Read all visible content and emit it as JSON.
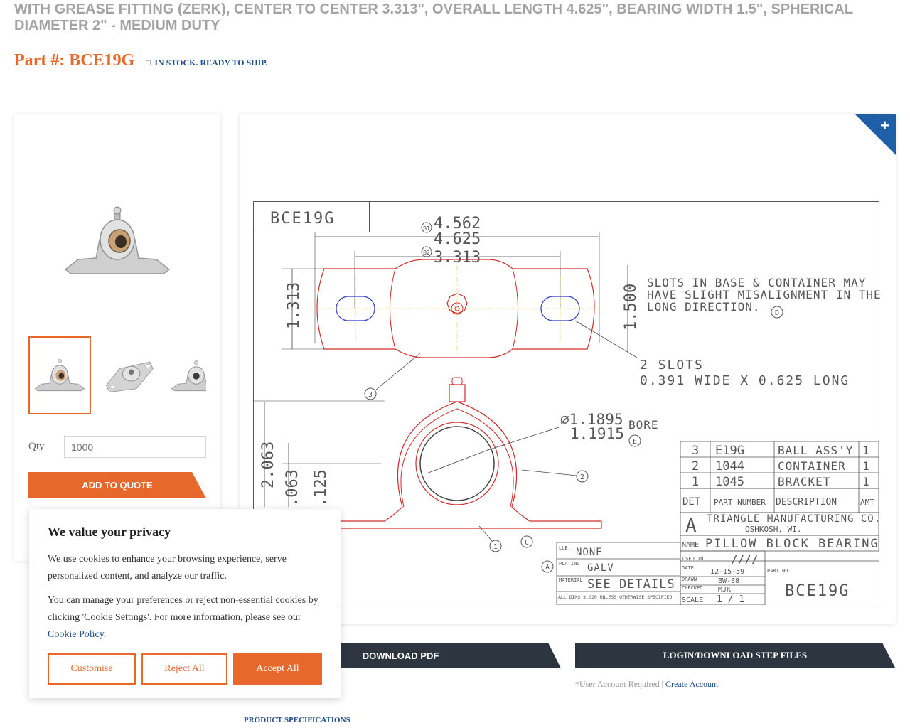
{
  "product": {
    "title": "WITH GREASE FITTING (ZERK), CENTER TO CENTER 3.313\", OVERALL LENGTH 4.625\", BEARING WIDTH 1.5\", SPHERICAL DIAMETER 2\" - MEDIUM DUTY",
    "part_label": "Part #: BCE19G",
    "stock_status": "IN STOCK. READY TO SHIP."
  },
  "purchase": {
    "qty_label": "Qty",
    "qty_placeholder": "1000",
    "add_to_quote": "ADD TO QUOTE"
  },
  "drawing": {
    "part_box": "BCE19G",
    "dims": {
      "b1": "4.562",
      "b2": "4.625",
      "c2c": "3.313",
      "h1": "1.313",
      "h2": "1.500",
      "v1": "2.063",
      "v2": ".063",
      "v3": ".125",
      "bore1": "⌀1.1895",
      "bore2": "1.1915",
      "bore_label": "BORE"
    },
    "callouts": {
      "b1": "B1",
      "b2": "B2",
      "d": "D",
      "e": "E",
      "a": "A",
      "c": "C",
      "n1": "1",
      "n2": "2",
      "n3": "3"
    },
    "notes": {
      "line1": "SLOTS IN BASE & CONTAINER MAY",
      "line2": "HAVE SLIGHT MISALIGNMENT IN THE",
      "line3": "LONG DIRECTION.",
      "slots1": "2 SLOTS",
      "slots2": "0.391 WIDE X 0.625 LONG"
    },
    "bom": [
      {
        "det": "3",
        "part": "E19G",
        "desc": "BALL ASS'Y",
        "amt": "1"
      },
      {
        "det": "2",
        "part": "1044",
        "desc": "CONTAINER",
        "amt": "1"
      },
      {
        "det": "1",
        "part": "1045",
        "desc": "BRACKET",
        "amt": "1"
      }
    ],
    "bom_headers": {
      "det": "DET",
      "part": "PART NUMBER",
      "desc": "DESCRIPTION",
      "amt": "AMT"
    },
    "title_block": {
      "company": "TRIANGLE MANUFACTURING CO.",
      "city": "OSHKOSH, WI.",
      "name_label": "NAME",
      "name": "PILLOW BLOCK BEARING",
      "used_in_label": "USED IN",
      "used_in": "////",
      "date_label": "DATE",
      "date": "12-15-59",
      "drawn_label": "DRAWN",
      "drawn": "BW-88",
      "checked_label": "CHECKED",
      "checked": "MJK",
      "scale_label": "SCALE",
      "scale": "1 / 1",
      "partno_label": "PART NO.",
      "partno": "BCE19G",
      "lub_label": "LUB.",
      "lub": "NONE",
      "plating_label": "PLATING",
      "plating": "GALV",
      "material_label": "MATERIAL",
      "material": "SEE DETAILS",
      "tolerance": "ALL DIMS ±.020 UNLESS OTHERWISE SPECIFIED"
    }
  },
  "downloads": {
    "pdf": "DOWNLOAD PDF",
    "step": "LOGIN/DOWNLOAD STEP FILES",
    "note": "*User Account Required | ",
    "create": "Create Account"
  },
  "tabs": {
    "product_specs": "PRODUCT SPECIFICATIONS"
  },
  "cookie": {
    "title": "We value your privacy",
    "body1": "We use cookies to enhance your browsing experience, serve personalized content, and analyze our traffic.",
    "body2": "You can manage your preferences or reject non-essential cookies by clicking 'Cookie Settings'. For more information, please see our",
    "policy": "Cookie Policy.",
    "customise": "Customise",
    "reject": "Reject All",
    "accept": "Accept All"
  },
  "colors": {
    "accent": "#e8672a",
    "navy": "#1f4e8c",
    "dark_button": "#2d3540",
    "drawing_red": "#d42a2a"
  }
}
